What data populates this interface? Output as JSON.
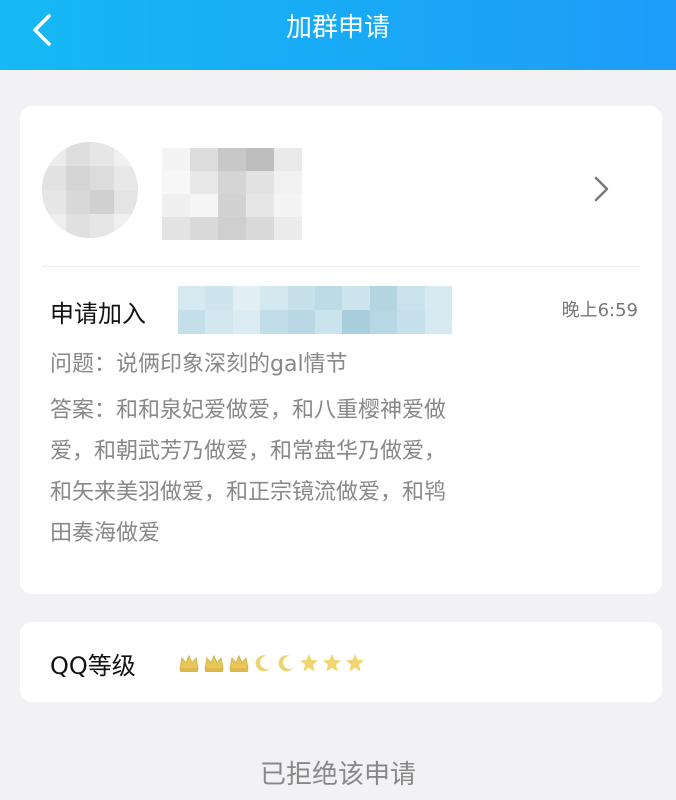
{
  "header": {
    "title": "加群申请",
    "background": "#19aaf6",
    "back_icon": "chevron-left-icon"
  },
  "applicant": {
    "avatar": "blurred-avatar",
    "nickname_blurred": true,
    "arrow_icon": "chevron-right-icon"
  },
  "request": {
    "label": "申请加入",
    "group_name_blurred": true,
    "time": "晚上6:59",
    "question": "问题：说俩印象深刻的gal情节",
    "answer_lines": [
      "答案：和和泉妃爱做爱，和八重樱神爱做",
      "爱，和朝武芳乃做爱，和常盘华乃做爱，",
      "和矢来美羽做爱，和正宗镜流做爱，和鸨",
      "田奏海做爱"
    ]
  },
  "qq_level": {
    "label": "QQ等级",
    "icons": [
      "crown",
      "crown",
      "crown",
      "moon",
      "moon",
      "star",
      "star",
      "star"
    ],
    "colors": {
      "crown": "#e8c75a",
      "moon": "#ecd474",
      "star": "#f0d66e"
    }
  },
  "status": {
    "text": "已拒绝该申请"
  }
}
